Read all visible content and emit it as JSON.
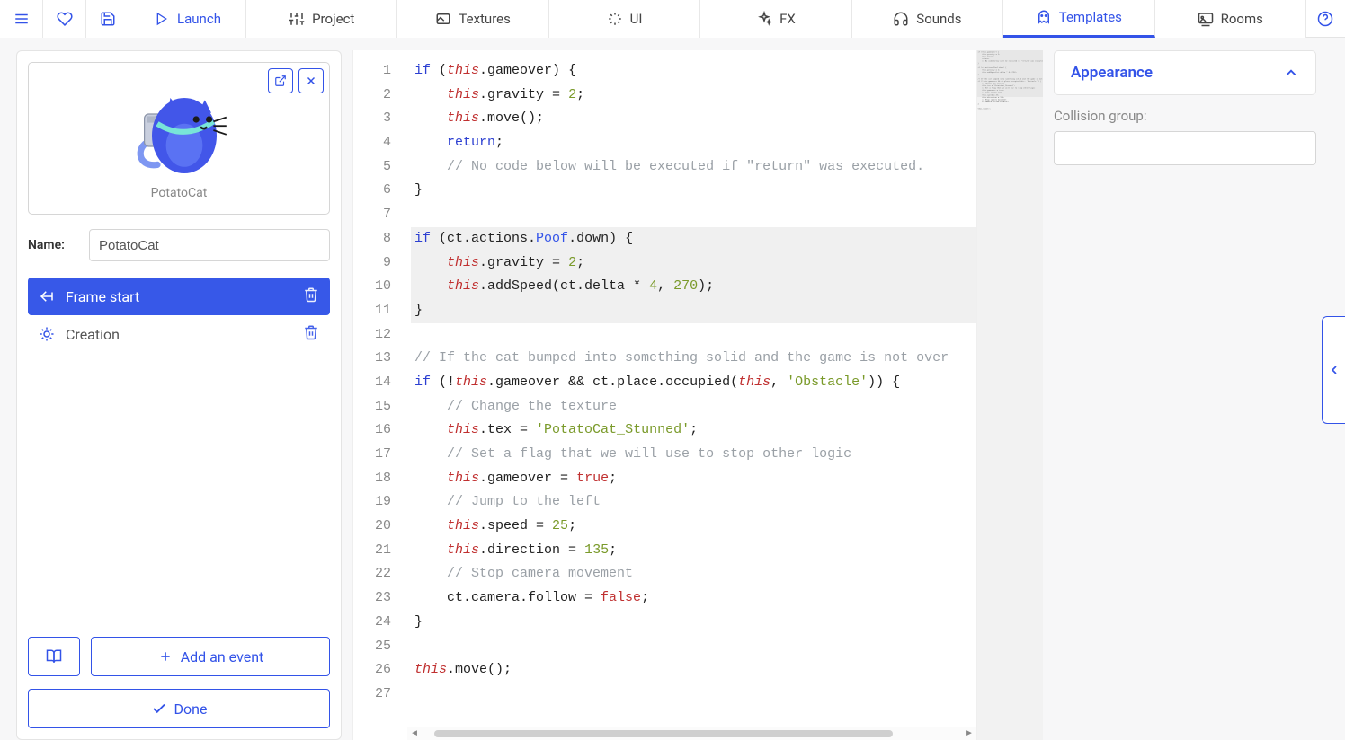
{
  "toolbar": {
    "launch": "Launch",
    "project": "Project",
    "textures": "Textures",
    "ui": "UI",
    "fx": "FX",
    "sounds": "Sounds",
    "templates": "Templates",
    "rooms": "Rooms"
  },
  "leftPanel": {
    "thumbLabel": "PotatoCat",
    "nameLabel": "Name:",
    "nameValue": "PotatoCat",
    "events": [
      {
        "label": "Frame start",
        "active": true
      },
      {
        "label": "Creation",
        "active": false
      }
    ],
    "addEvent": "Add an event",
    "done": "Done"
  },
  "rightPanel": {
    "appearance": "Appearance",
    "collisionGroup": "Collision group:",
    "collisionValue": ""
  },
  "code": {
    "lines": [
      [
        [
          "kw",
          "if"
        ],
        [
          "",
          " ("
        ],
        [
          "th",
          "this"
        ],
        [
          "",
          ".gameover) {"
        ]
      ],
      [
        [
          "",
          "    "
        ],
        [
          "th",
          "this"
        ],
        [
          "",
          ".gravity = "
        ],
        [
          "num",
          "2"
        ],
        [
          "",
          ";"
        ]
      ],
      [
        [
          "",
          "    "
        ],
        [
          "th",
          "this"
        ],
        [
          "",
          ".move();"
        ]
      ],
      [
        [
          "",
          "    "
        ],
        [
          "kw",
          "return"
        ],
        [
          "",
          ";"
        ]
      ],
      [
        [
          "",
          "    "
        ],
        [
          "cm",
          "// No code below will be executed if \"return\" was executed."
        ]
      ],
      [
        [
          "",
          "}"
        ]
      ],
      [
        [
          "",
          ""
        ]
      ],
      [
        [
          "kw",
          "if"
        ],
        [
          "",
          " (ct.actions."
        ],
        [
          "mem",
          "Poof"
        ],
        [
          "",
          ".down) {"
        ]
      ],
      [
        [
          "",
          "    "
        ],
        [
          "th",
          "this"
        ],
        [
          "",
          ".gravity = "
        ],
        [
          "num",
          "2"
        ],
        [
          "",
          ";"
        ]
      ],
      [
        [
          "",
          "    "
        ],
        [
          "th",
          "this"
        ],
        [
          "",
          ".addSpeed(ct.delta * "
        ],
        [
          "num",
          "4"
        ],
        [
          "",
          ", "
        ],
        [
          "num",
          "270"
        ],
        [
          "",
          ");"
        ]
      ],
      [
        [
          "",
          "}"
        ]
      ],
      [
        [
          "",
          ""
        ]
      ],
      [
        [
          "cm",
          "// If the cat bumped into something solid and the game is not over"
        ]
      ],
      [
        [
          "kw",
          "if"
        ],
        [
          "",
          " (!"
        ],
        [
          "th",
          "this"
        ],
        [
          "",
          ".gameover && ct.place.occupied("
        ],
        [
          "th",
          "this"
        ],
        [
          "",
          ", "
        ],
        [
          "str",
          "'Obstacle'"
        ],
        [
          "",
          ")) {"
        ]
      ],
      [
        [
          "",
          "    "
        ],
        [
          "cm",
          "// Change the texture"
        ]
      ],
      [
        [
          "",
          "    "
        ],
        [
          "th",
          "this"
        ],
        [
          "",
          ".tex = "
        ],
        [
          "str",
          "'PotatoCat_Stunned'"
        ],
        [
          "",
          ";"
        ]
      ],
      [
        [
          "",
          "    "
        ],
        [
          "cm",
          "// Set a flag that we will use to stop other logic"
        ]
      ],
      [
        [
          "",
          "    "
        ],
        [
          "th",
          "this"
        ],
        [
          "",
          ".gameover = "
        ],
        [
          "bool",
          "true"
        ],
        [
          "",
          ";"
        ]
      ],
      [
        [
          "",
          "    "
        ],
        [
          "cm",
          "// Jump to the left"
        ]
      ],
      [
        [
          "",
          "    "
        ],
        [
          "th",
          "this"
        ],
        [
          "",
          ".speed = "
        ],
        [
          "num",
          "25"
        ],
        [
          "",
          ";"
        ]
      ],
      [
        [
          "",
          "    "
        ],
        [
          "th",
          "this"
        ],
        [
          "",
          ".direction = "
        ],
        [
          "num",
          "135"
        ],
        [
          "",
          ";"
        ]
      ],
      [
        [
          "",
          "    "
        ],
        [
          "cm",
          "// Stop camera movement"
        ]
      ],
      [
        [
          "",
          "    ct.camera.follow = "
        ],
        [
          "bool",
          "false"
        ],
        [
          "",
          ";"
        ]
      ],
      [
        [
          "",
          "}"
        ]
      ],
      [
        [
          "",
          ""
        ]
      ],
      [
        [
          "th",
          "this"
        ],
        [
          "",
          ".move();"
        ]
      ],
      [
        [
          "",
          ""
        ]
      ]
    ],
    "highlighted": [
      8,
      9,
      10,
      11
    ],
    "current": 9
  }
}
